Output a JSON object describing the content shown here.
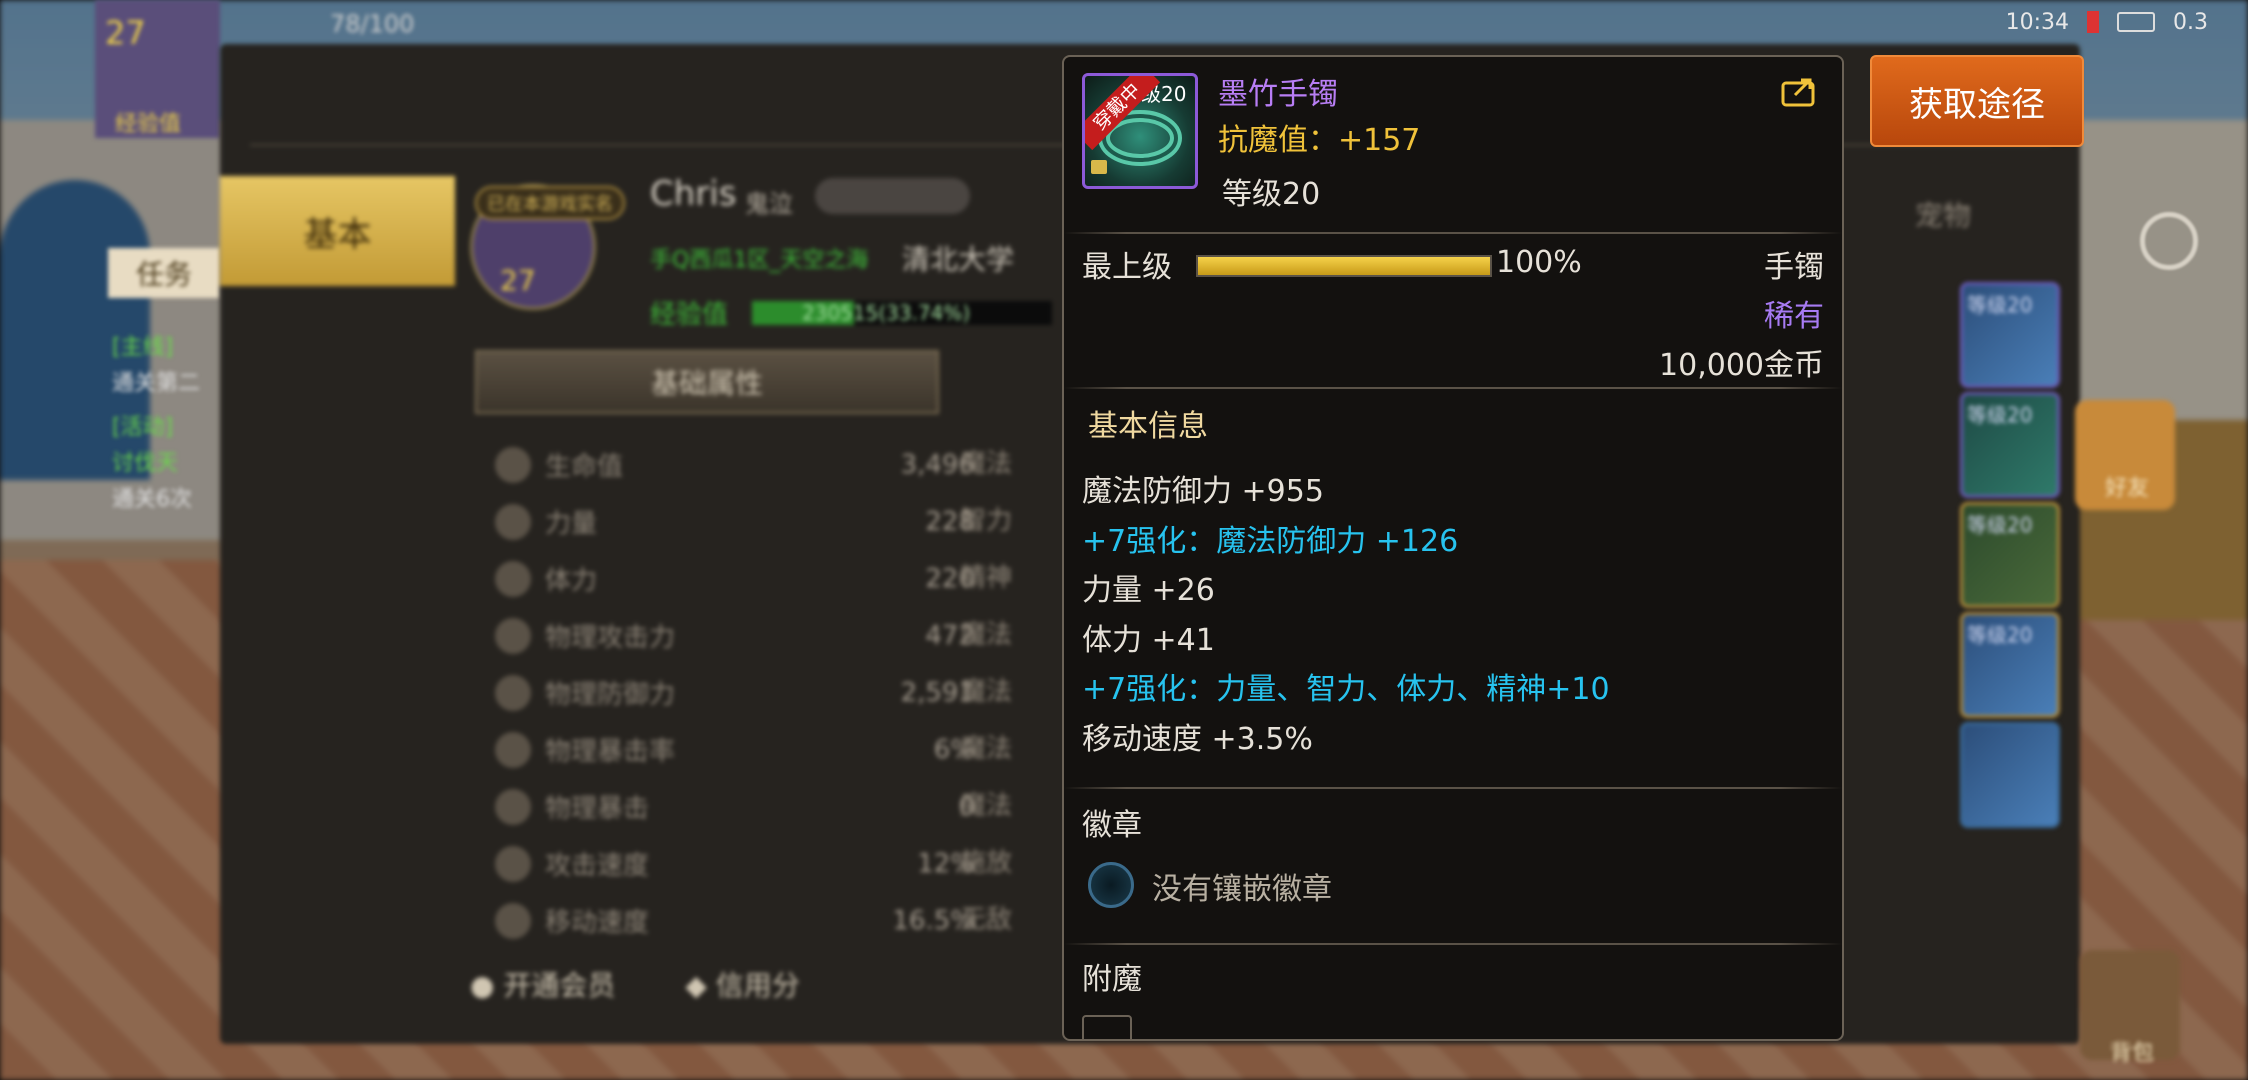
{
  "status_bar": {
    "time": "10:34",
    "network": "0.3"
  },
  "character": {
    "name": "Chris",
    "job": "鬼泣",
    "level": "27",
    "guild_tag": "已在本游戏实名",
    "guild": "手Q西瓜1区_天空之海",
    "school": "清北大学",
    "exp_label": "经验值",
    "exp_value": "230515(33.74%)",
    "stamina": "78/100"
  },
  "char_tabs": {
    "basic": "基本",
    "pet": "宠物"
  },
  "attr_section": {
    "title": "基础属性"
  },
  "attributes": [
    {
      "name": "生命值",
      "value": "3,496"
    },
    {
      "name": "力量",
      "value": "228"
    },
    {
      "name": "体力",
      "value": "220"
    },
    {
      "name": "物理攻击力",
      "value": "472"
    },
    {
      "name": "物理防御力",
      "value": "2,591"
    },
    {
      "name": "物理暴击率",
      "value": "6%"
    },
    {
      "name": "物理暴击",
      "value": "0"
    },
    {
      "name": "攻击速度",
      "value": "12%"
    },
    {
      "name": "移动速度",
      "value": "16.5%"
    }
  ],
  "attr_right_col": [
    "魔法",
    "智力",
    "精神",
    "魔法",
    "魔法",
    "魔法",
    "魔法",
    "施放",
    "无敌"
  ],
  "bottom_bar": {
    "vip": "开通会员",
    "credit": "信用分"
  },
  "left_hud": {
    "exp_label": "经验值",
    "quest_tab": "任务",
    "quests": [
      "[主线]",
      "通关第二",
      "[活动]",
      "讨伐天",
      "通关6次"
    ]
  },
  "right_hud": {
    "slots": [
      "等级20",
      "等级20",
      "等级20",
      "等级20"
    ],
    "labels": [
      "好友",
      "背包"
    ]
  },
  "tooltip": {
    "item_name": "墨竹手镯",
    "wearing_badge": "穿戴中",
    "slot_level_tag": "等级20",
    "magic_resist": "抗魔值：+157",
    "level": "等级20",
    "grade_label": "最上级",
    "grade_percent": "100%",
    "grade_fill": 1.0,
    "item_type": "手镯",
    "rarity": "稀有",
    "price": "10,000金币",
    "section_basic": "基本信息",
    "stats": [
      {
        "text": "魔法防御力 +955",
        "color": "normal"
      },
      {
        "text": "+7强化：魔法防御力 +126",
        "color": "cyan"
      },
      {
        "text": "力量 +26",
        "color": "normal"
      },
      {
        "text": "体力 +41",
        "color": "normal"
      },
      {
        "text": "+7强化：力量、智力、体力、精神+10",
        "color": "cyan"
      },
      {
        "text": "移动速度 +3.5%",
        "color": "normal"
      }
    ],
    "section_emblem": "徽章",
    "emblem_empty": "没有镶嵌徽章",
    "section_enchant": "附魔"
  },
  "obtain_button": "获取途径",
  "colors": {
    "item_name": "#b87ef5",
    "gold": "#f0c23a",
    "rarity": "#a77bf3",
    "cyan": "#27c3ef",
    "obtain_btn": "#d4601a"
  }
}
